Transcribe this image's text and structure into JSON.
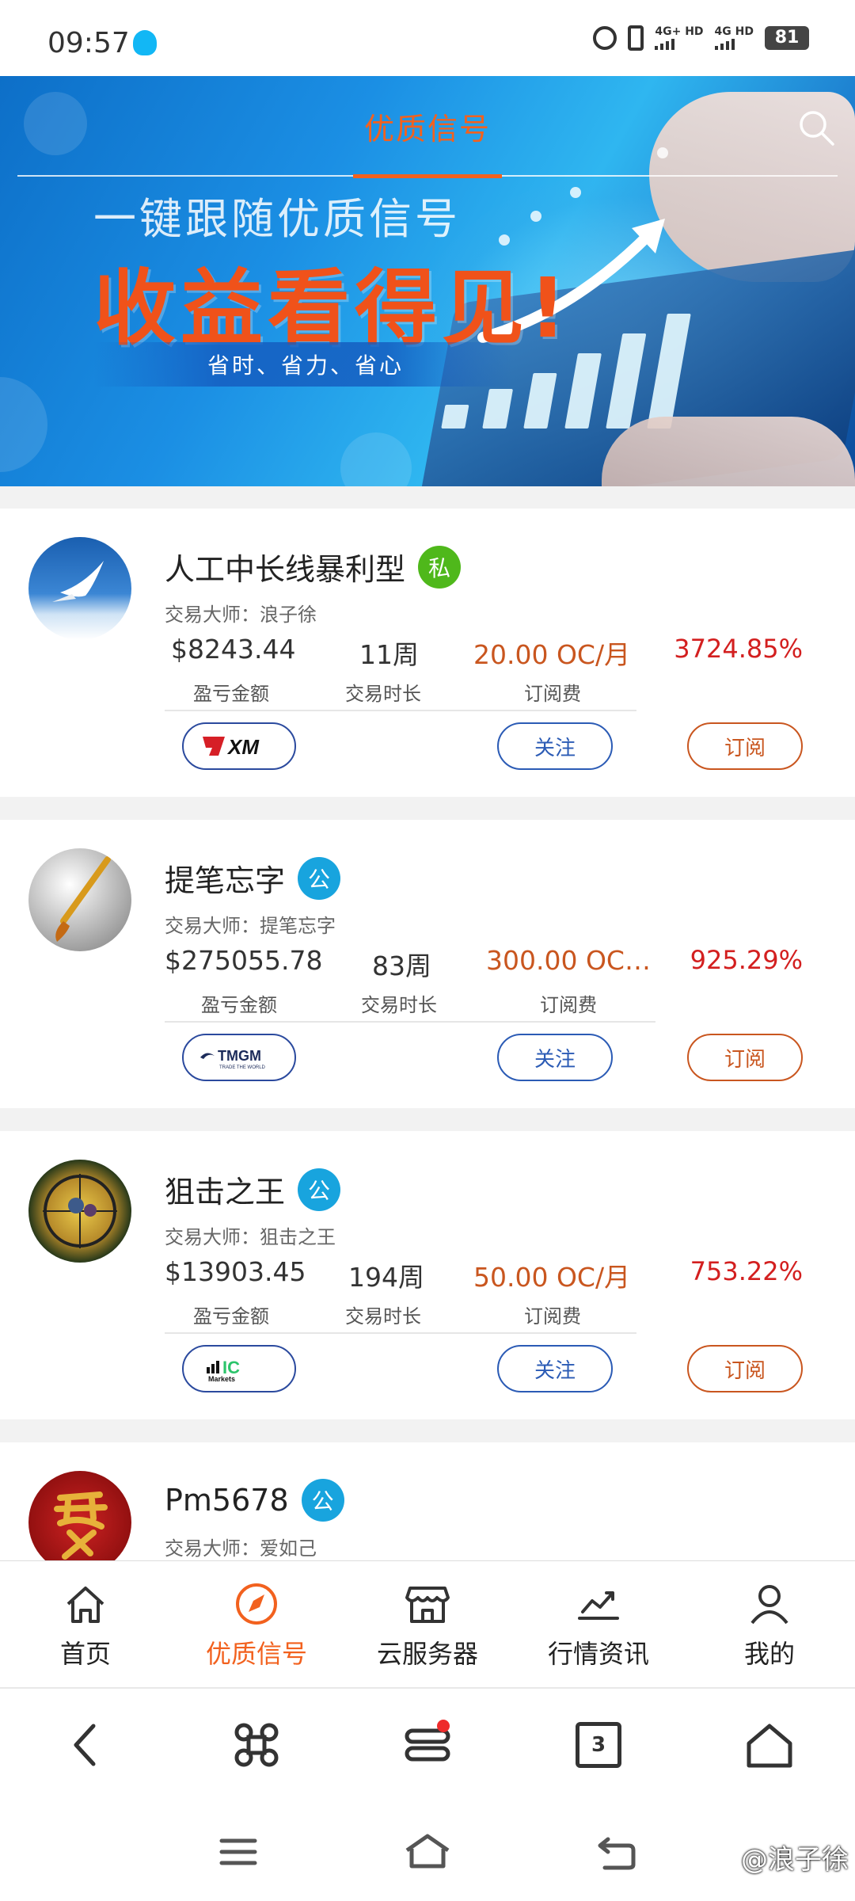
{
  "status_bar": {
    "time": "09:57",
    "net1": "4G+ HD",
    "net2": "4G HD",
    "battery": "81"
  },
  "banner": {
    "title": "优质信号",
    "line1": "一键跟随优质信号",
    "line2": "收益看得见!",
    "subtitle": "省时、省力、省心"
  },
  "signals": [
    {
      "name": "人工中长线暴利型",
      "badge": "私",
      "badge_type": "private",
      "master": "交易大师：浪子徐",
      "amount": "$8243.44",
      "duration": "11周",
      "fee": "20.00 OC/月",
      "ratio": "3724.85%",
      "broker": "XM",
      "amount_label": "盈亏金额",
      "duration_label": "交易时长",
      "fee_label": "订阅费",
      "follow_label": "关注",
      "subscribe_label": "订阅"
    },
    {
      "name": "提笔忘字",
      "badge": "公",
      "badge_type": "public",
      "master": "交易大师：提笔忘字",
      "amount": "$275055.78",
      "duration": "83周",
      "fee": "300.00 OC…",
      "ratio": "925.29%",
      "broker": "TMGM",
      "amount_label": "盈亏金额",
      "duration_label": "交易时长",
      "fee_label": "订阅费",
      "follow_label": "关注",
      "subscribe_label": "订阅"
    },
    {
      "name": "狙击之王",
      "badge": "公",
      "badge_type": "public",
      "master": "交易大师：狙击之王",
      "amount": "$13903.45",
      "duration": "194周",
      "fee": "50.00 OC/月",
      "ratio": "753.22%",
      "broker": "IC Markets",
      "amount_label": "盈亏金额",
      "duration_label": "交易时长",
      "fee_label": "订阅费",
      "follow_label": "关注",
      "subscribe_label": "订阅"
    },
    {
      "name": "Pm5678",
      "badge": "公",
      "badge_type": "public",
      "master": "交易大师：爱如己"
    }
  ],
  "app_nav": [
    {
      "label": "首页",
      "icon": "home-icon",
      "active": false
    },
    {
      "label": "优质信号",
      "icon": "compass-icon",
      "active": true
    },
    {
      "label": "云服务器",
      "icon": "store-icon",
      "active": false
    },
    {
      "label": "行情资讯",
      "icon": "chart-icon",
      "active": false
    },
    {
      "label": "我的",
      "icon": "user-icon",
      "active": false
    }
  ],
  "browser_bar": {
    "tab_count": "3"
  },
  "watermark": "@浪子徐",
  "colors": {
    "accent": "#f2611e",
    "private_badge": "#4fb81b",
    "public_badge": "#18a4de",
    "ratio": "#d31f1f",
    "follow": "#2b5bb5"
  }
}
